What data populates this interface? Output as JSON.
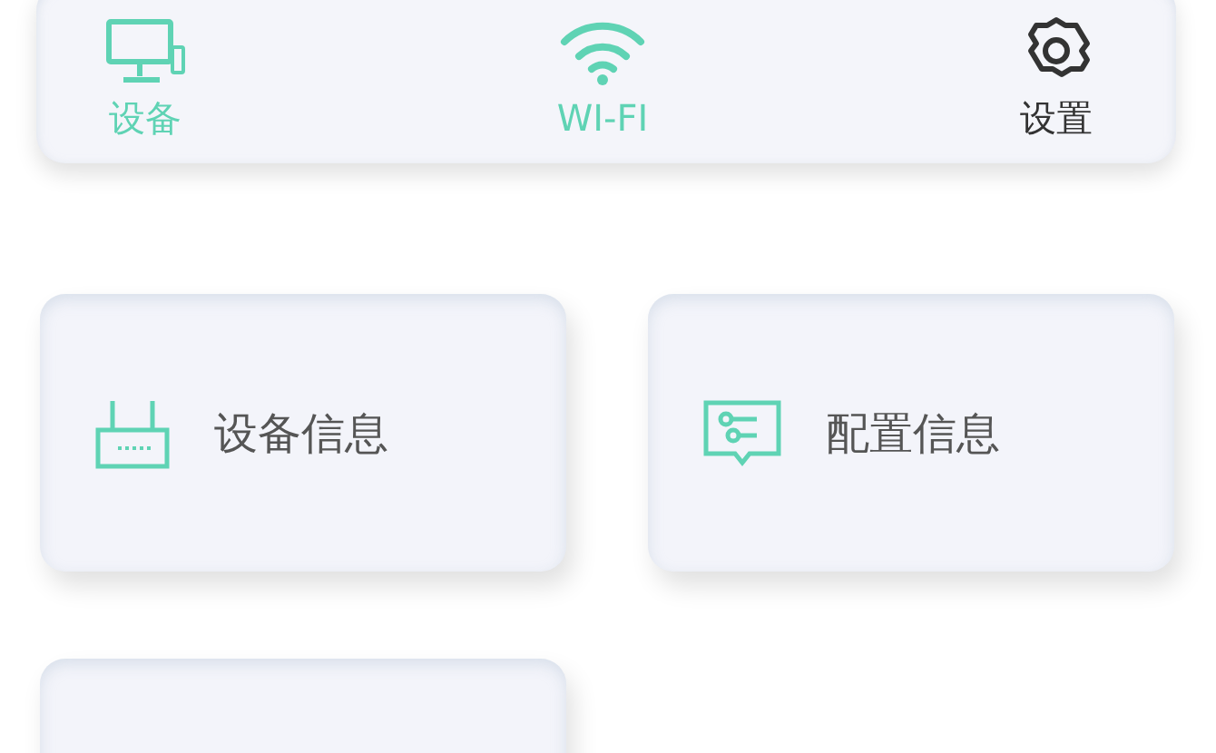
{
  "tabs": [
    {
      "kind": "devices",
      "label": "设备",
      "selected": true
    },
    {
      "kind": "wifi",
      "label": "WI-FI",
      "selected": true
    },
    {
      "kind": "settings",
      "label": "设置",
      "selected": false
    }
  ],
  "cards": [
    {
      "kind": "router",
      "label": "设备信息"
    },
    {
      "kind": "config",
      "label": "配置信息"
    },
    {
      "kind": "blank"
    }
  ]
}
